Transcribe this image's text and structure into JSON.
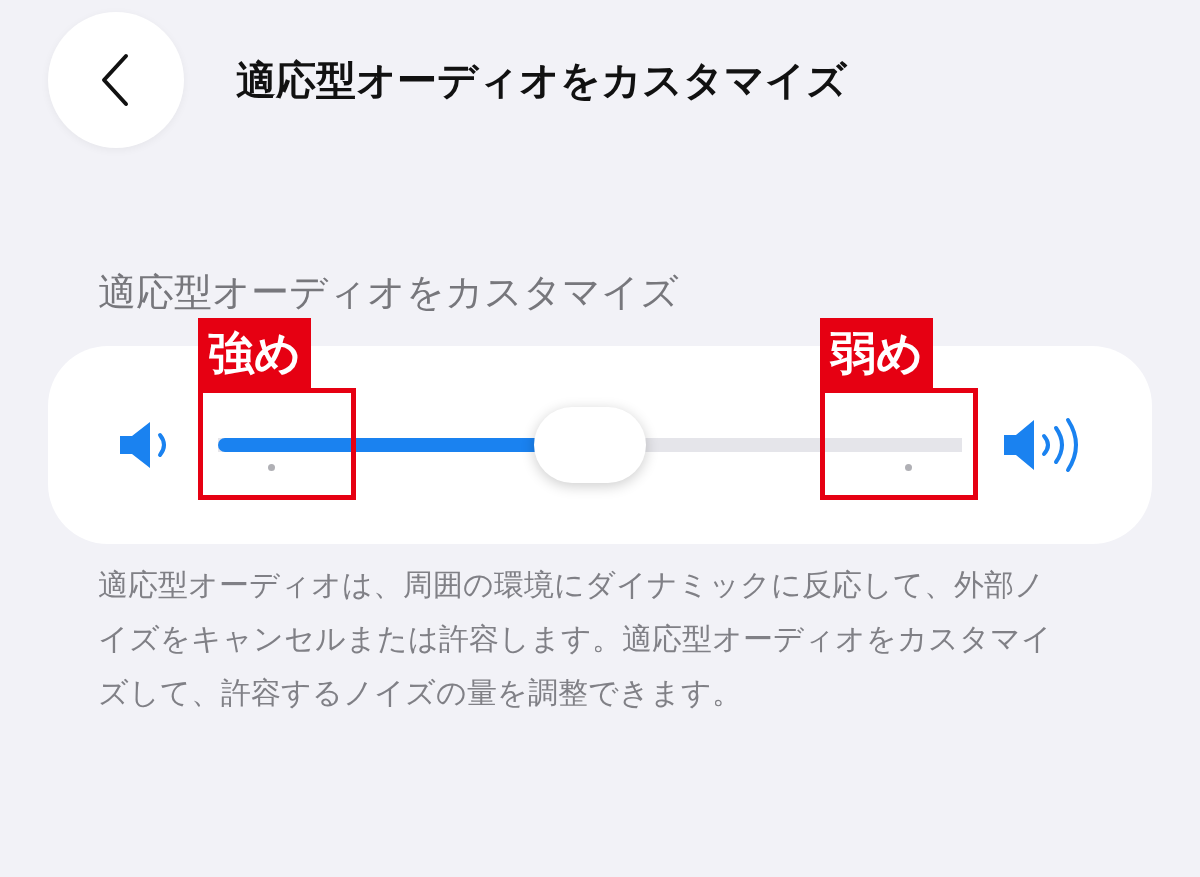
{
  "header": {
    "title": "適応型オーディオをカスタマイズ"
  },
  "section": {
    "header": "適応型オーディオをカスタマイズ"
  },
  "slider": {
    "level": 0.5
  },
  "annotations": [
    {
      "label": "強め"
    },
    {
      "label": "弱め"
    }
  ],
  "description": "適応型オーディオは、周囲の環境にダイナミックに反応して、外部ノイズをキャンセルまたは許容します。適応型オーディオをカスタマイズして、許容するノイズの量を調整できます。"
}
